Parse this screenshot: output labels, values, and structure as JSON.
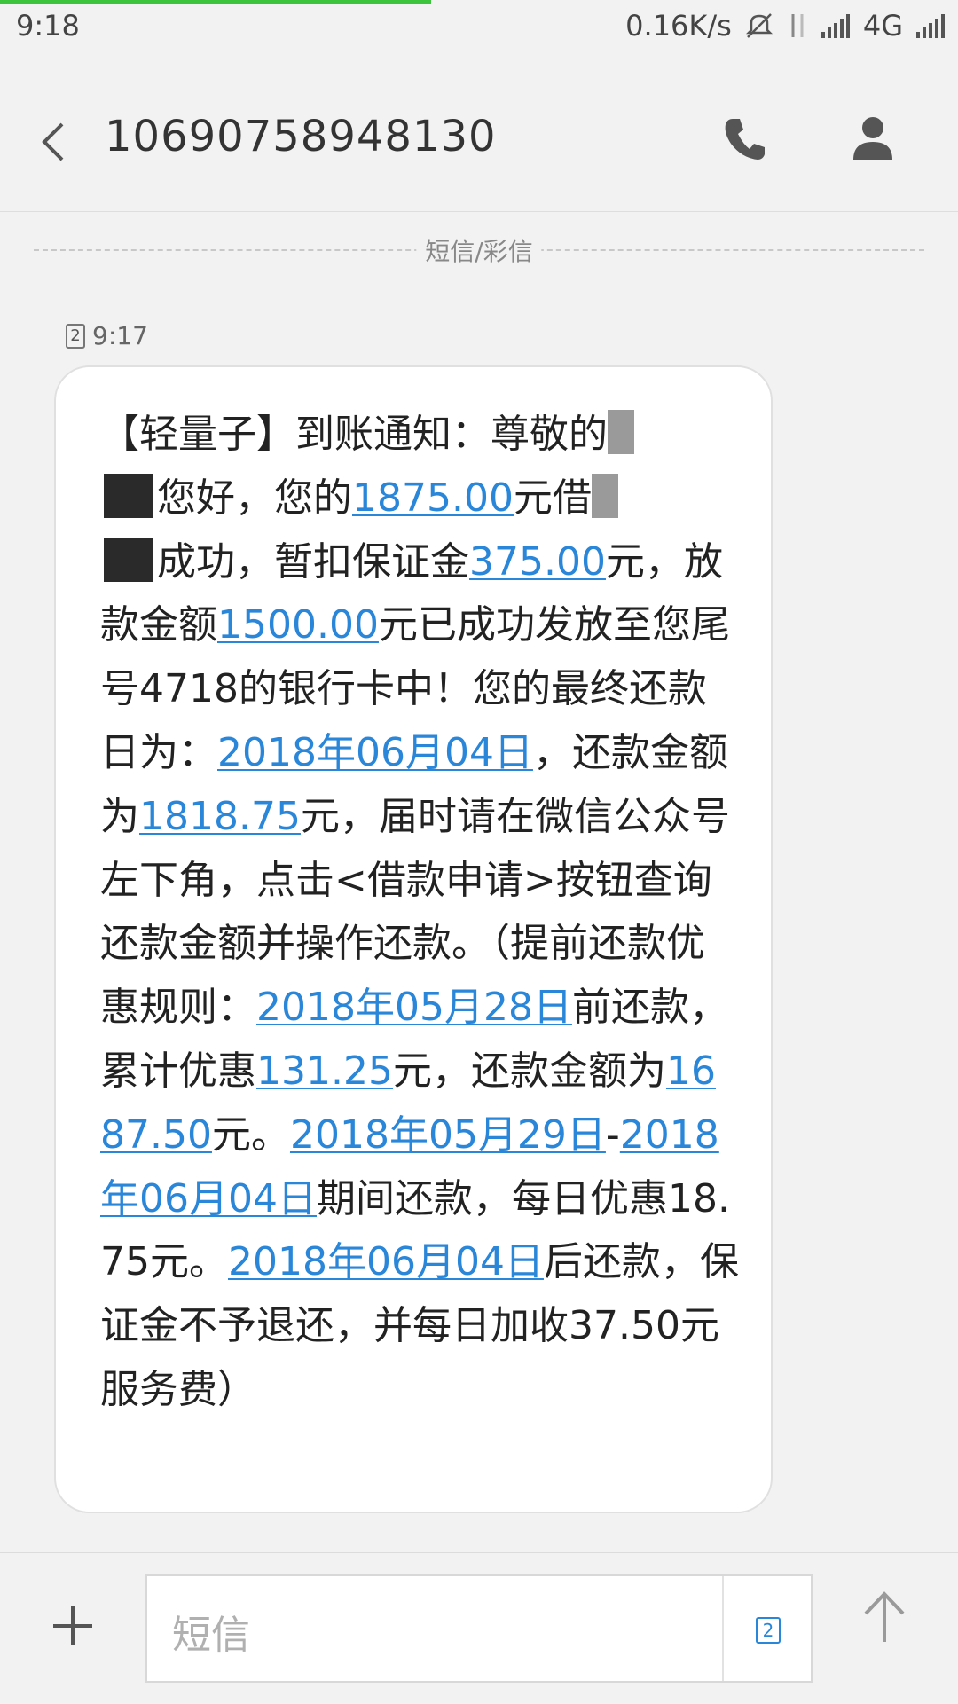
{
  "status_bar": {
    "time": "9:18",
    "net_speed": "0.16K/s",
    "network": "4G"
  },
  "header": {
    "title": "10690758948130",
    "back_icon": "chevron-left-icon",
    "call_icon": "phone-icon",
    "profile_icon": "person-icon"
  },
  "divider": {
    "label": "短信/彩信"
  },
  "message": {
    "sim": "2",
    "time": "9:17",
    "segments": {
      "s1": "【轻量子】到账通知：尊敬的",
      "s2": "您好，您的",
      "amount_loan": "1875.00",
      "s3": "元借",
      "s4": "成功，暂扣保证金",
      "amount_deposit": "375.00",
      "s5": "元，放款金额",
      "amount_release": "1500.00",
      "s6": "元已成功发放至您尾号4718的银行卡中！您的最终还款日为：",
      "date_due": "2018年06月04日",
      "s7": "，还款金额为",
      "amount_repay": "1818.75",
      "s8": "元，届时请在微信公众号左下角，点击<借款申请>按钮查询还款金额并操作还款。（提前还款优惠规则：",
      "date_early": "2018年05月28日",
      "s9": "前还款，累计优惠",
      "amount_discount": "131.25",
      "s10": "元，还款金额为",
      "amount_early_repay": "1687.50",
      "s11": "元。",
      "date_range_start": "2018年05月29日",
      "dash": "-",
      "date_range_end": "2018年06月04日",
      "s12": "期间还款，每日优惠18.75元。",
      "date_late": "2018年06月04日",
      "s13": "后还款，保证金不予退还，并每日加收37.50元服务费）"
    }
  },
  "input_bar": {
    "placeholder": "短信",
    "sim": "2",
    "plus_icon": "plus-icon",
    "send_icon": "arrow-up-icon"
  },
  "colors": {
    "link": "#2a86d8",
    "background": "#f2f2f2",
    "bubble": "#ffffff",
    "progress": "#3cc43c"
  }
}
